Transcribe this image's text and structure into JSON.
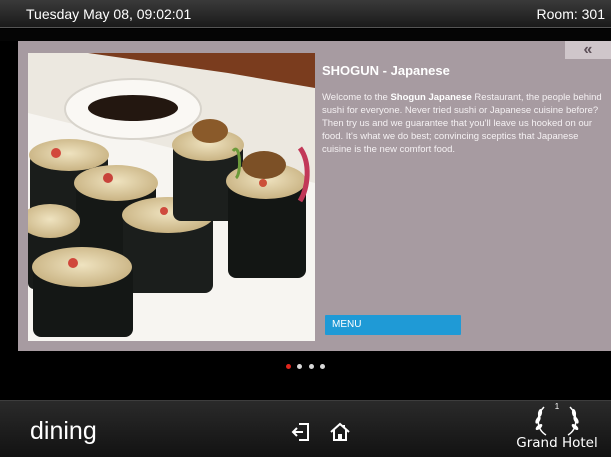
{
  "header": {
    "datetime": "Tuesday May 08, 09:02:01",
    "room": "Room: 301"
  },
  "panel": {
    "collapse_label": "«",
    "title": "SHOGUN - Japanese",
    "desc_prefix": "Welcome to the ",
    "desc_bold": "Shogun Japanese",
    "desc_rest": " Restaurant, the people behind sushi for everyone. Never tried sushi or Japanese cuisine before? Then try us and we guarantee that you'll leave us hooked on our food. It's what we do best; convincing sceptics that Japanese cuisine is the new comfort food.",
    "menu_label": "MENU"
  },
  "pager": {
    "count": 4,
    "active_index": 0
  },
  "footer": {
    "section": "dining",
    "logo_number": "1",
    "logo_text": "Grand Hotel"
  },
  "colors": {
    "panel_bg": "#a79ba1",
    "menu_button": "#1f9ad6",
    "active_dot": "#e0261d"
  }
}
